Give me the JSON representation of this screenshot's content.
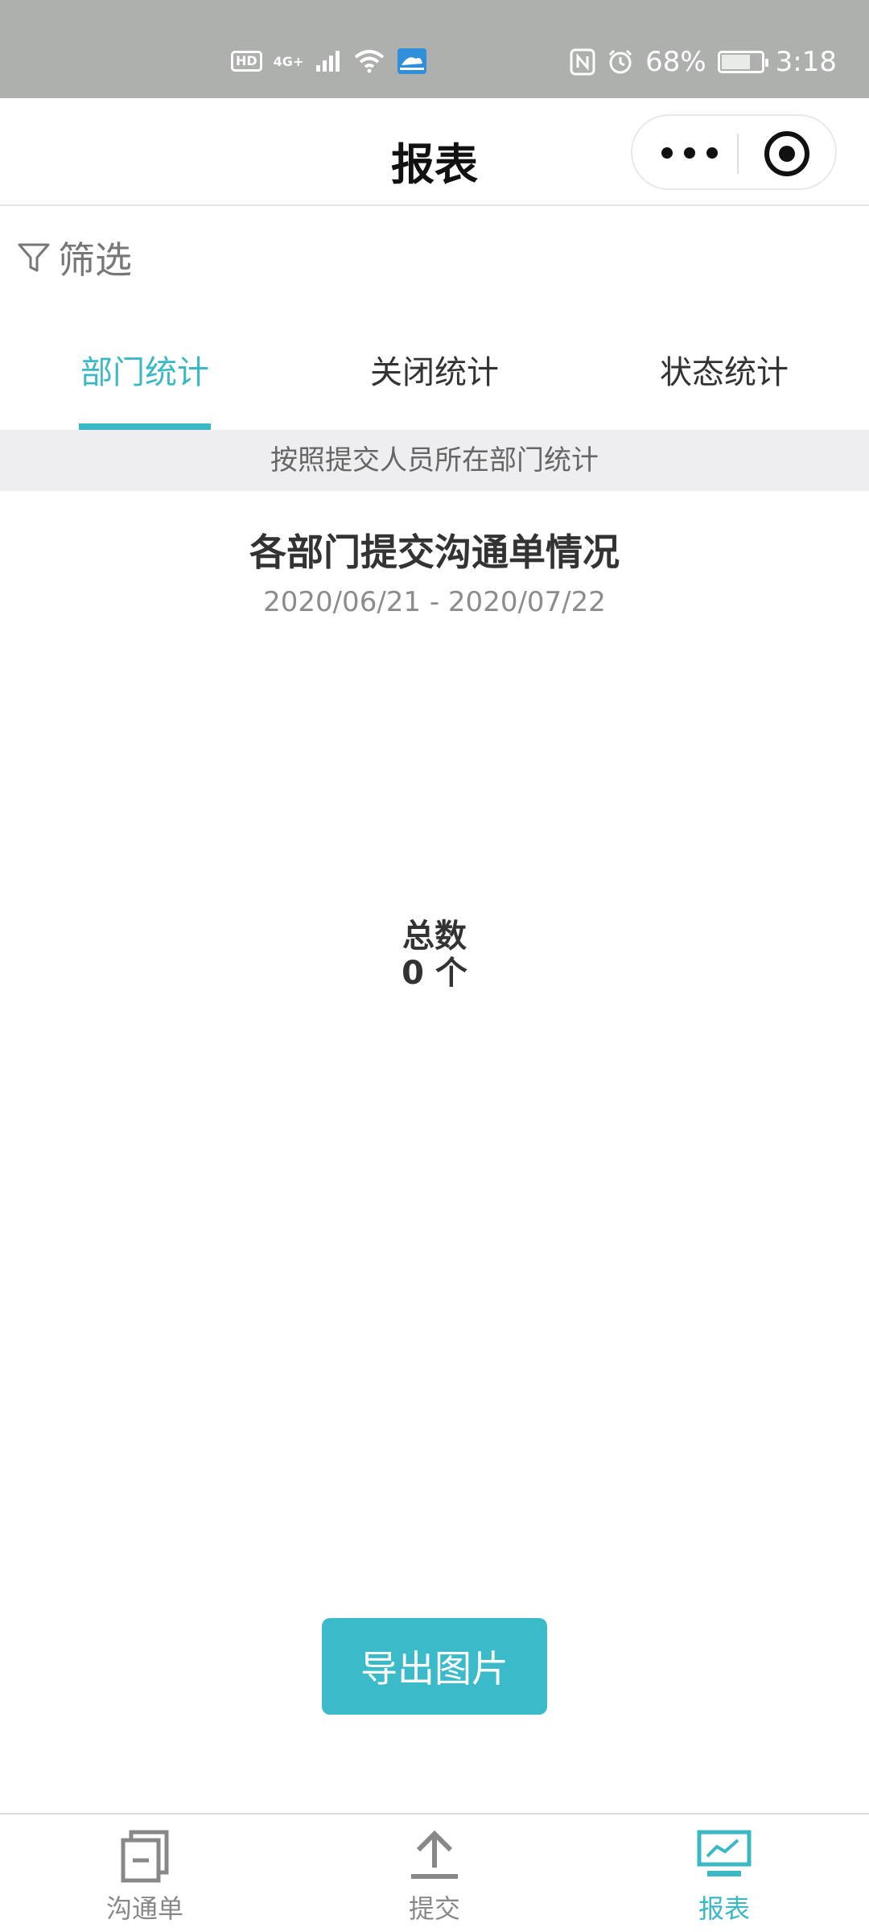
{
  "status_bar": {
    "network": "HD",
    "signal": "4G+",
    "battery_percent": "68%",
    "battery_level": 0.68,
    "time": "3:18"
  },
  "nav": {
    "title": "报表"
  },
  "filter": {
    "label": "筛选"
  },
  "tabs": [
    {
      "label": "部门统计",
      "active": true
    },
    {
      "label": "关闭统计",
      "active": false
    },
    {
      "label": "状态统计",
      "active": false
    }
  ],
  "info": {
    "text": "按照提交人员所在部门统计"
  },
  "report": {
    "title": "各部门提交沟通单情况",
    "date_range": "2020/06/21 - 2020/07/22",
    "total_label": "总数",
    "total_value": "0 个"
  },
  "export": {
    "label": "导出图片"
  },
  "tab_bar": [
    {
      "label": "沟通单",
      "icon": "document-icon",
      "active": false
    },
    {
      "label": "提交",
      "icon": "upload-icon",
      "active": false
    },
    {
      "label": "报表",
      "icon": "chart-icon",
      "active": true
    }
  ],
  "colors": {
    "accent": "#3bb8c6",
    "status_bar": "#aeb0ae"
  }
}
